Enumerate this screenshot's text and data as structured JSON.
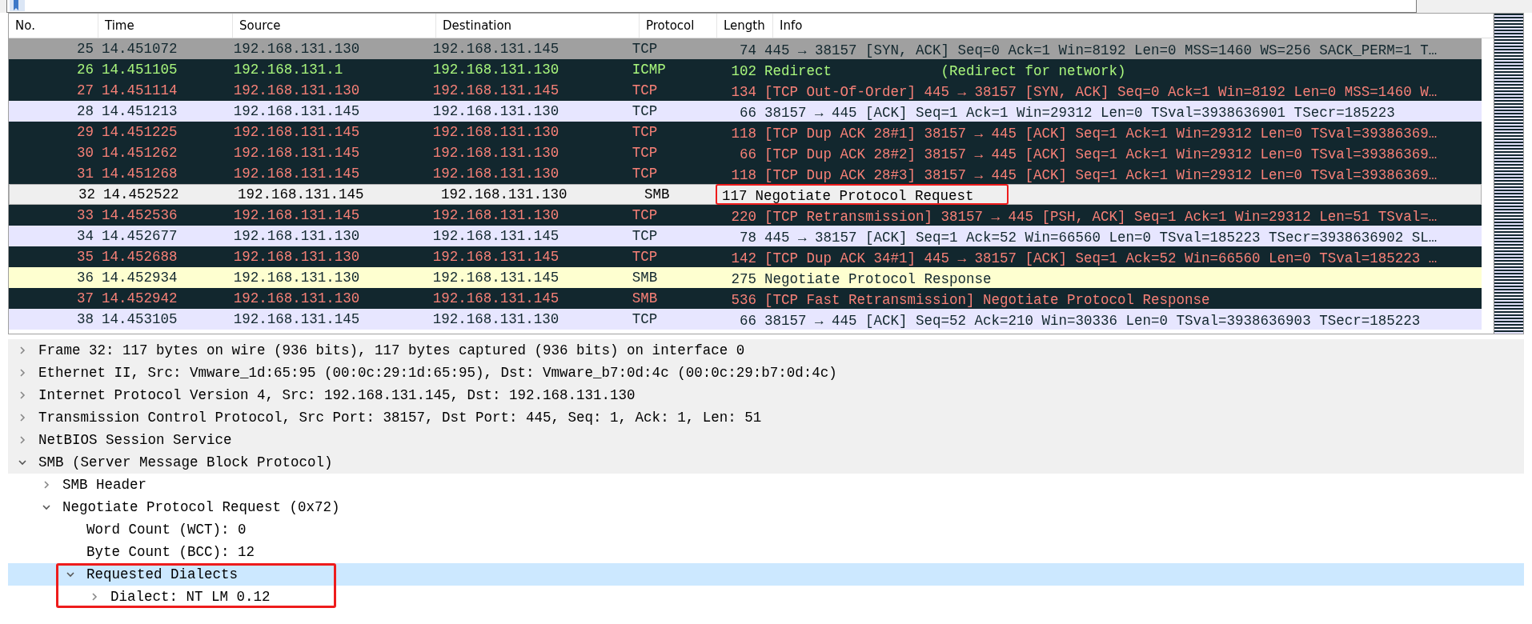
{
  "packet_list": {
    "columns": [
      "No.",
      "Time",
      "Source",
      "Destination",
      "Protocol",
      "Length",
      "Info"
    ],
    "rows": [
      {
        "no": "25",
        "time": "14.451072",
        "source": "192.168.131.130",
        "destination": "192.168.131.145",
        "protocol": "TCP",
        "length": "74",
        "info": "445 → 38157 [SYN, ACK] Seq=0 Ack=1 Win=8192 Len=0 MSS=1460 WS=256 SACK_PERM=1 T…",
        "kind": "gray",
        "selected": false,
        "annotated": false
      },
      {
        "no": "26",
        "time": "14.451105",
        "source": "192.168.131.1",
        "destination": "192.168.131.130",
        "protocol": "ICMP",
        "length": "102",
        "info": "Redirect             (Redirect for network)",
        "kind": "icmp",
        "selected": false,
        "annotated": false
      },
      {
        "no": "27",
        "time": "14.451114",
        "source": "192.168.131.130",
        "destination": "192.168.131.145",
        "protocol": "TCP",
        "length": "134",
        "info": "[TCP Out-Of-Order] 445 → 38157 [SYN, ACK] Seq=0 Ack=1 Win=8192 Len=0 MSS=1460 W…",
        "kind": "bad",
        "selected": false,
        "annotated": false
      },
      {
        "no": "28",
        "time": "14.451213",
        "source": "192.168.131.145",
        "destination": "192.168.131.130",
        "protocol": "TCP",
        "length": "66",
        "info": "38157 → 445 [ACK] Seq=1 Ack=1 Win=29312 Len=0 TSval=3938636901 TSecr=185223",
        "kind": "tcp",
        "selected": false,
        "annotated": false
      },
      {
        "no": "29",
        "time": "14.451225",
        "source": "192.168.131.145",
        "destination": "192.168.131.130",
        "protocol": "TCP",
        "length": "118",
        "info": "[TCP Dup ACK 28#1] 38157 → 445 [ACK] Seq=1 Ack=1 Win=29312 Len=0 TSval=39386369…",
        "kind": "bad",
        "selected": false,
        "annotated": false
      },
      {
        "no": "30",
        "time": "14.451262",
        "source": "192.168.131.145",
        "destination": "192.168.131.130",
        "protocol": "TCP",
        "length": "66",
        "info": "[TCP Dup ACK 28#2] 38157 → 445 [ACK] Seq=1 Ack=1 Win=29312 Len=0 TSval=39386369…",
        "kind": "bad",
        "selected": false,
        "annotated": false
      },
      {
        "no": "31",
        "time": "14.451268",
        "source": "192.168.131.145",
        "destination": "192.168.131.130",
        "protocol": "TCP",
        "length": "118",
        "info": "[TCP Dup ACK 28#3] 38157 → 445 [ACK] Seq=1 Ack=1 Win=29312 Len=0 TSval=39386369…",
        "kind": "bad",
        "selected": false,
        "annotated": false
      },
      {
        "no": "32",
        "time": "14.452522",
        "source": "192.168.131.145",
        "destination": "192.168.131.130",
        "protocol": "SMB",
        "length": "117",
        "info": "Negotiate Protocol Request",
        "kind": "smb",
        "selected": true,
        "annotated": true
      },
      {
        "no": "33",
        "time": "14.452536",
        "source": "192.168.131.145",
        "destination": "192.168.131.130",
        "protocol": "TCP",
        "length": "220",
        "info": "[TCP Retransmission] 38157 → 445 [PSH, ACK] Seq=1 Ack=1 Win=29312 Len=51 TSval=…",
        "kind": "bad",
        "selected": false,
        "annotated": false
      },
      {
        "no": "34",
        "time": "14.452677",
        "source": "192.168.131.130",
        "destination": "192.168.131.145",
        "protocol": "TCP",
        "length": "78",
        "info": "445 → 38157 [ACK] Seq=1 Ack=52 Win=66560 Len=0 TSval=185223 TSecr=3938636902 SL…",
        "kind": "tcp",
        "selected": false,
        "annotated": false
      },
      {
        "no": "35",
        "time": "14.452688",
        "source": "192.168.131.130",
        "destination": "192.168.131.145",
        "protocol": "TCP",
        "length": "142",
        "info": "[TCP Dup ACK 34#1] 445 → 38157 [ACK] Seq=1 Ack=52 Win=66560 Len=0 TSval=185223 …",
        "kind": "bad",
        "selected": false,
        "annotated": false
      },
      {
        "no": "36",
        "time": "14.452934",
        "source": "192.168.131.130",
        "destination": "192.168.131.145",
        "protocol": "SMB",
        "length": "275",
        "info": "Negotiate Protocol Response",
        "kind": "smb",
        "selected": false,
        "annotated": false
      },
      {
        "no": "37",
        "time": "14.452942",
        "source": "192.168.131.130",
        "destination": "192.168.131.145",
        "protocol": "SMB",
        "length": "536",
        "info": "[TCP Fast Retransmission] Negotiate Protocol Response",
        "kind": "bad",
        "selected": false,
        "annotated": false
      },
      {
        "no": "38",
        "time": "14.453105",
        "source": "192.168.131.145",
        "destination": "192.168.131.130",
        "protocol": "TCP",
        "length": "66",
        "info": "38157 → 445 [ACK] Seq=52 Ack=210 Win=30336 Len=0 TSval=3938636903 TSecr=185223",
        "kind": "tcp",
        "selected": false,
        "annotated": false
      }
    ]
  },
  "packet_details": [
    {
      "label": "Frame 32: 117 bytes on wire (936 bits), 117 bytes captured (936 bits) on interface 0",
      "kind": "branch",
      "expanded": false,
      "selected": false,
      "annotated": false
    },
    {
      "label": "Ethernet II, Src: Vmware_1d:65:95 (00:0c:29:1d:65:95), Dst: Vmware_b7:0d:4c (00:0c:29:b7:0d:4c)",
      "kind": "branch",
      "expanded": false,
      "selected": false,
      "annotated": false
    },
    {
      "label": "Internet Protocol Version 4, Src: 192.168.131.145, Dst: 192.168.131.130",
      "kind": "branch",
      "expanded": false,
      "selected": false,
      "annotated": false
    },
    {
      "label": "Transmission Control Protocol, Src Port: 38157, Dst Port: 445, Seq: 1, Ack: 1, Len: 51",
      "kind": "branch",
      "expanded": false,
      "selected": false,
      "annotated": false
    },
    {
      "label": "NetBIOS Session Service",
      "kind": "branch",
      "expanded": false,
      "selected": false,
      "annotated": false
    },
    {
      "label": "SMB (Server Message Block Protocol)",
      "kind": "branch",
      "expanded": true,
      "selected": false,
      "annotated": false,
      "children": [
        {
          "label": "SMB Header",
          "kind": "branch",
          "expanded": false,
          "selected": false,
          "annotated": false
        },
        {
          "label": "Negotiate Protocol Request (0x72)",
          "kind": "branch",
          "expanded": true,
          "selected": false,
          "annotated": false,
          "children": [
            {
              "label": "Word Count (WCT): 0",
              "kind": "leaf",
              "selected": false,
              "annotated": false
            },
            {
              "label": "Byte Count (BCC): 12",
              "kind": "leaf",
              "selected": false,
              "annotated": false
            },
            {
              "label": "Requested Dialects",
              "kind": "branch",
              "expanded": true,
              "selected": true,
              "annotated": true,
              "children": [
                {
                  "label": "Dialect: NT LM 0.12",
                  "kind": "branch",
                  "expanded": false,
                  "selected": false,
                  "annotated": false
                }
              ]
            }
          ]
        }
      ]
    }
  ]
}
